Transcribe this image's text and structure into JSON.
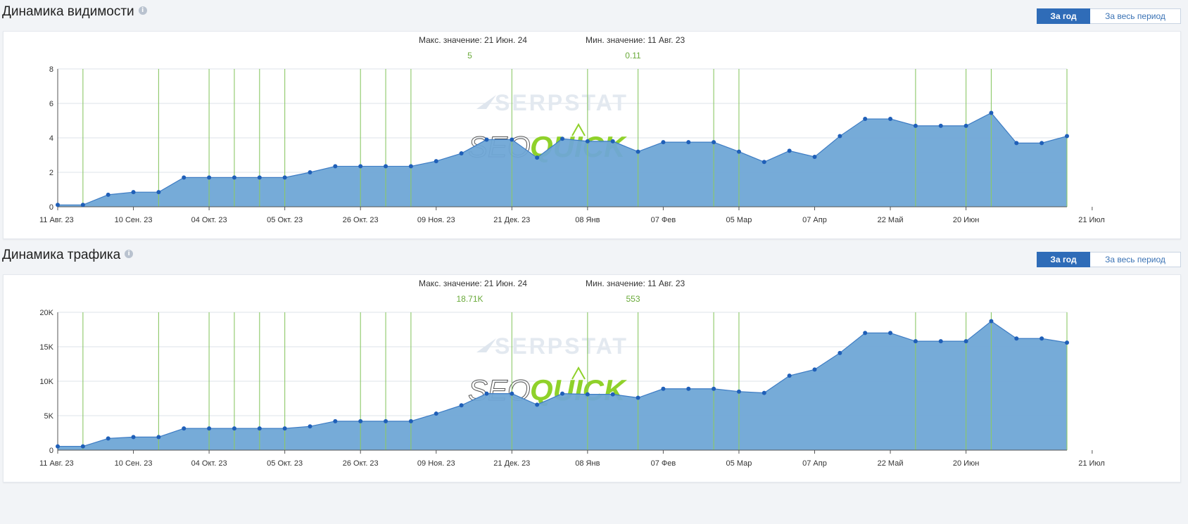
{
  "panels": [
    {
      "title": "Динамика видимости",
      "buttons": {
        "year": "За год",
        "all": "За весь период"
      },
      "max_label": "Макс. значение: 21 Июн. 24",
      "max_value": "5",
      "min_label": "Мин. значение: 11 Авг. 23",
      "min_value": "0.11"
    },
    {
      "title": "Динамика трафика",
      "buttons": {
        "year": "За год",
        "all": "За весь период"
      },
      "max_label": "Макс. значение: 21 Июн. 24",
      "max_value": "18.71K",
      "min_label": "Мин. значение: 11 Авг. 23",
      "min_value": "553"
    }
  ],
  "watermarks": {
    "serpstat": "SERPSTAT",
    "seo": "SEO",
    "quick": "QUICK"
  },
  "colors": {
    "area": "#6fa6d6",
    "line": "#3d7cc4",
    "point": "#1f5fb8",
    "vline": "#8cc867",
    "accent": "#2f6cb8"
  },
  "chart_data": [
    {
      "type": "area",
      "x_tick_labels": [
        "11 Авг. 23",
        "10 Сен. 23",
        "04 Окт. 23",
        "05 Окт. 23",
        "26 Окт. 23",
        "09 Ноя. 23",
        "21 Дек. 23",
        "08 Янв",
        "07 Фев",
        "05 Мар",
        "07 Апр",
        "22 Май",
        "20 Июн",
        "21 Июл"
      ],
      "x_tick_index": [
        0,
        3,
        6,
        9,
        12,
        15,
        18,
        21,
        24,
        27,
        30,
        33,
        36,
        41
      ],
      "y_ticks": [
        0,
        2,
        4,
        6,
        8
      ],
      "y_tick_labels": [
        "0",
        "2",
        "4",
        "6",
        "8"
      ],
      "ylim": [
        0,
        8
      ],
      "values": [
        0.11,
        0.11,
        0.7,
        0.85,
        0.85,
        1.7,
        1.7,
        1.7,
        1.7,
        1.7,
        2.0,
        2.35,
        2.35,
        2.35,
        2.35,
        2.65,
        3.1,
        3.9,
        3.9,
        2.85,
        3.95,
        3.8,
        3.8,
        3.2,
        3.75,
        3.75,
        3.75,
        3.2,
        2.6,
        3.25,
        2.9,
        4.1,
        5.1,
        5.1,
        4.7,
        4.7,
        4.7,
        5.45,
        3.7,
        3.7,
        4.1
      ],
      "vline_index": [
        1,
        4,
        6,
        7,
        8,
        9,
        12,
        13,
        14,
        18,
        21,
        23,
        26,
        27,
        34,
        36,
        37,
        40
      ],
      "grid": true
    },
    {
      "type": "area",
      "x_tick_labels": [
        "11 Авг. 23",
        "10 Сен. 23",
        "04 Окт. 23",
        "05 Окт. 23",
        "26 Окт. 23",
        "09 Ноя. 23",
        "21 Дек. 23",
        "08 Янв",
        "07 Фев",
        "05 Мар",
        "07 Апр",
        "22 Май",
        "20 Июн",
        "21 Июл"
      ],
      "x_tick_index": [
        0,
        3,
        6,
        9,
        12,
        15,
        18,
        21,
        24,
        27,
        30,
        33,
        36,
        41
      ],
      "y_ticks": [
        0,
        5000,
        10000,
        15000,
        20000
      ],
      "y_tick_labels": [
        "0",
        "5K",
        "10K",
        "15K",
        "20K"
      ],
      "ylim": [
        0,
        20000
      ],
      "values": [
        553,
        553,
        1700,
        1900,
        1900,
        3150,
        3150,
        3150,
        3150,
        3150,
        3450,
        4200,
        4200,
        4200,
        4200,
        5300,
        6500,
        8200,
        8200,
        6600,
        8200,
        8100,
        8100,
        7600,
        8900,
        8900,
        8900,
        8500,
        8300,
        10800,
        11700,
        14100,
        17000,
        17000,
        15800,
        15800,
        15800,
        18710,
        16200,
        16200,
        15600
      ],
      "vline_index": [
        1,
        4,
        6,
        7,
        8,
        9,
        12,
        13,
        14,
        18,
        21,
        23,
        26,
        27,
        34,
        36,
        37,
        40
      ],
      "grid": true
    }
  ]
}
